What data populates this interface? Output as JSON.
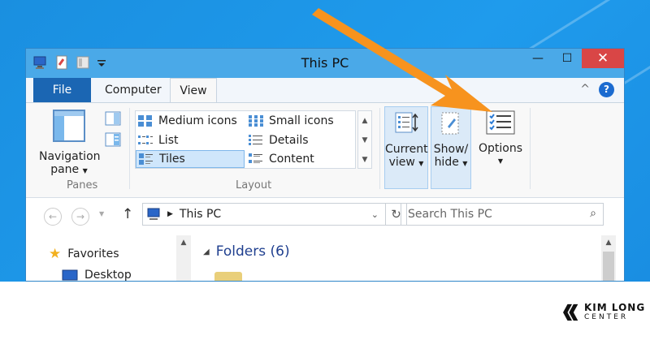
{
  "window": {
    "title": "This PC",
    "controls": {
      "minimize": "—",
      "maximize": "☐",
      "close": "✕"
    }
  },
  "ribbon_tabs": {
    "file": "File",
    "computer": "Computer",
    "view": "View",
    "collapse": "^",
    "help": "?"
  },
  "panes": {
    "navigation_pane_line1": "Navigation",
    "navigation_pane_line2": "pane",
    "group_label": "Panes"
  },
  "layout": {
    "group_label": "Layout",
    "items": [
      "Medium icons",
      "Small icons",
      "List",
      "Details",
      "Tiles",
      "Content"
    ],
    "selected": "Tiles"
  },
  "view_buttons": {
    "current_view_line1": "Current",
    "current_view_line2": "view",
    "show_hide_line1": "Show/",
    "show_hide_line2": "hide",
    "options": "Options"
  },
  "address": {
    "path": "This PC",
    "search_placeholder": "Search This PC"
  },
  "nav_tree": {
    "favorites": "Favorites",
    "desktop": "Desktop"
  },
  "main": {
    "folders_header": "Folders (6)"
  },
  "watermark": {
    "brand_line1": "KIM LONG",
    "brand_line2": "CENTER"
  },
  "colors": {
    "arrow": "#f7931e",
    "desktop": "#1f96e8",
    "file_tab": "#1b66b3",
    "close": "#d94646"
  }
}
